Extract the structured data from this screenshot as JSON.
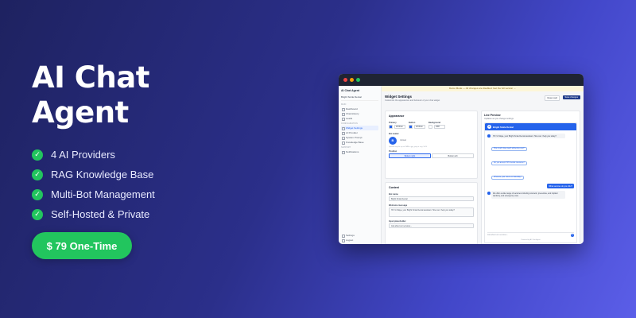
{
  "hero": {
    "title": "AI Chat Agent",
    "features": [
      "4 AI Providers",
      "RAG Knowledge Base",
      "Multi-Bot Management",
      "Self-Hosted & Private"
    ],
    "price": "$ 79 One-Time"
  },
  "colors": {
    "success": "#22c55e",
    "primary": "#2563eb",
    "navy": "#1e3a8a"
  },
  "app": {
    "banner": "Demo Mode — All changes are disabled. Get the full version →",
    "sidebar": {
      "brand": "AI Chat Agent",
      "bot": "Bright Smile Dental",
      "sections": {
        "main": "MAIN",
        "config": "CONFIGURATION",
        "support": "SUPPORT"
      },
      "main_items": [
        "Dashboard",
        "Chat History",
        "Leads"
      ],
      "config_items": [
        "Widget Settings",
        "AI Provider",
        "System Prompt",
        "Knowledge Base"
      ],
      "support_items": [
        "Notifications"
      ],
      "bottom_items": [
        "Settings",
        "Logout"
      ]
    },
    "header": {
      "title": "Widget Settings",
      "subtitle": "Customize the appearance and behavior of your chat widget",
      "reset_label": "Reset card",
      "save_label": "Save changes"
    },
    "appearance": {
      "title": "Appearance",
      "primary_label": "Primary",
      "primary_value": "#2563eb",
      "primary_color": "#2563eb",
      "button_label": "Button",
      "button_value": "#2563eb",
      "button_color": "#2563eb",
      "background_label": "Background",
      "background_value": "#ffffff",
      "background_color": "#ffffff",
      "avatar_label": "Bot avatar",
      "avatar_letter": "B",
      "upload_label": "Upload",
      "hint": "Upload any file up to 2MB in jpg, png or svg. SVG",
      "position_label": "Position",
      "positions": [
        "Bottom right",
        "Bottom left"
      ]
    },
    "content": {
      "title": "Content",
      "botname_label": "Bot name",
      "botname_value": "Bright Smile Dental",
      "welcome_label": "Welcome message",
      "welcome_value": "Hi! I'm Maya, your Bright Smile Dental assistant. How can I help you today?",
      "placeholder_label": "Input placeholder",
      "placeholder_value": "Ask about our services..."
    },
    "preview": {
      "title": "Live Preview",
      "subtitle": "Updates as you change settings",
      "bot_name": "Bright Smile Dental",
      "greeting": "Hi! I'm Maya, your Bright Smile Dental assistant. How can I help you today?",
      "chips": [
        "How much does teeth whitening cost?",
        "Do you accept PPO dental insurance?",
        "What are your hours on Saturday?"
      ],
      "user_msg": "What services do you offer?",
      "bot_reply": "We offer a wide range of services including cosmetic, preventive, and implant dentistry, and emergency care.",
      "input_placeholder": "Ask about our services...",
      "powered": "Powered by AI Chat Agent"
    }
  }
}
